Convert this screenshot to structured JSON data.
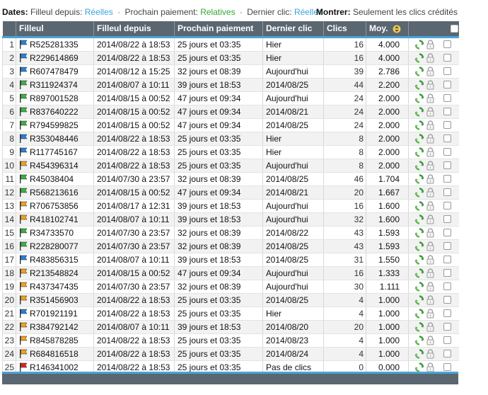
{
  "topbar": {
    "dates_label": "Dates:",
    "filleul_label": "Filleul depuis:",
    "filleul_value": "Réelles",
    "prochain_label": "Prochain paiement:",
    "prochain_value": "Relatives",
    "dernier_label": "Dernier clic:",
    "dernier_value": "Réelles",
    "separator": "·",
    "montrer_label": "Montrer:",
    "montrer_value": "Seulement les clics crédités"
  },
  "table": {
    "headers": {
      "filleul": "Filleul",
      "depuis": "Filleul depuis",
      "prochain": "Prochain paiement",
      "dernier": "Dernier clic",
      "clics": "Clics",
      "moy": "Moy."
    },
    "rows": [
      {
        "n": "1",
        "flag": "blue",
        "id": "R525281335",
        "depuis": "2014/08/22 à 18:53",
        "prochain": "25 jours et 03:35",
        "dernier": "Hier",
        "clics": "16",
        "moy": "4.000"
      },
      {
        "n": "2",
        "flag": "blue",
        "id": "R229614869",
        "depuis": "2014/08/22 à 18:53",
        "prochain": "25 jours et 03:35",
        "dernier": "Hier",
        "clics": "16",
        "moy": "4.000"
      },
      {
        "n": "3",
        "flag": "blue",
        "id": "R607478479",
        "depuis": "2014/08/12 à 15:25",
        "prochain": "32 jours et 08:39",
        "dernier": "Aujourd'hui",
        "clics": "39",
        "moy": "2.786"
      },
      {
        "n": "4",
        "flag": "green",
        "id": "R311924374",
        "depuis": "2014/08/07 à 10:11",
        "prochain": "39 jours et 18:53",
        "dernier": "2014/08/25",
        "clics": "44",
        "moy": "2.200"
      },
      {
        "n": "5",
        "flag": "green",
        "id": "R897001528",
        "depuis": "2014/08/15 à 00:52",
        "prochain": "47 jours et 09:34",
        "dernier": "Aujourd'hui",
        "clics": "24",
        "moy": "2.000"
      },
      {
        "n": "6",
        "flag": "green",
        "id": "R837640222",
        "depuis": "2014/08/15 à 00:52",
        "prochain": "47 jours et 09:34",
        "dernier": "2014/08/21",
        "clics": "24",
        "moy": "2.000"
      },
      {
        "n": "7",
        "flag": "green",
        "id": "R794599825",
        "depuis": "2014/08/15 à 00:52",
        "prochain": "47 jours et 09:34",
        "dernier": "2014/08/25",
        "clics": "24",
        "moy": "2.000"
      },
      {
        "n": "8",
        "flag": "blue",
        "id": "R353048446",
        "depuis": "2014/08/22 à 18:53",
        "prochain": "25 jours et 03:35",
        "dernier": "Hier",
        "clics": "8",
        "moy": "2.000"
      },
      {
        "n": "9",
        "flag": "blue",
        "id": "R117745167",
        "depuis": "2014/08/22 à 18:53",
        "prochain": "25 jours et 03:35",
        "dernier": "Hier",
        "clics": "8",
        "moy": "2.000"
      },
      {
        "n": "10",
        "flag": "orange",
        "id": "R454396314",
        "depuis": "2014/08/22 à 18:53",
        "prochain": "25 jours et 03:35",
        "dernier": "Aujourd'hui",
        "clics": "8",
        "moy": "2.000"
      },
      {
        "n": "11",
        "flag": "green",
        "id": "R45038404",
        "depuis": "2014/07/30 à 23:57",
        "prochain": "32 jours et 08:39",
        "dernier": "2014/08/25",
        "clics": "46",
        "moy": "1.704"
      },
      {
        "n": "12",
        "flag": "green",
        "id": "R568213616",
        "depuis": "2014/08/15 à 00:52",
        "prochain": "47 jours et 09:34",
        "dernier": "2014/08/21",
        "clics": "20",
        "moy": "1.667"
      },
      {
        "n": "13",
        "flag": "orange",
        "id": "R706753856",
        "depuis": "2014/08/17 à 12:31",
        "prochain": "39 jours et 18:53",
        "dernier": "Aujourd'hui",
        "clics": "16",
        "moy": "1.600"
      },
      {
        "n": "14",
        "flag": "orange",
        "id": "R418102741",
        "depuis": "2014/08/07 à 10:11",
        "prochain": "39 jours et 18:53",
        "dernier": "Aujourd'hui",
        "clics": "32",
        "moy": "1.600"
      },
      {
        "n": "15",
        "flag": "green",
        "id": "R34733570",
        "depuis": "2014/07/30 à 23:57",
        "prochain": "32 jours et 08:39",
        "dernier": "2014/08/22",
        "clics": "43",
        "moy": "1.593"
      },
      {
        "n": "16",
        "flag": "green",
        "id": "R228280077",
        "depuis": "2014/07/30 à 23:57",
        "prochain": "32 jours et 08:39",
        "dernier": "2014/08/25",
        "clics": "43",
        "moy": "1.593"
      },
      {
        "n": "17",
        "flag": "blue",
        "id": "R483856315",
        "depuis": "2014/08/07 à 10:11",
        "prochain": "39 jours et 18:53",
        "dernier": "2014/08/25",
        "clics": "31",
        "moy": "1.550"
      },
      {
        "n": "18",
        "flag": "orange",
        "id": "R213548824",
        "depuis": "2014/08/15 à 00:52",
        "prochain": "47 jours et 09:34",
        "dernier": "Aujourd'hui",
        "clics": "16",
        "moy": "1.333"
      },
      {
        "n": "19",
        "flag": "orange",
        "id": "R437347435",
        "depuis": "2014/07/30 à 23:57",
        "prochain": "32 jours et 08:39",
        "dernier": "Aujourd'hui",
        "clics": "30",
        "moy": "1.111"
      },
      {
        "n": "20",
        "flag": "orange",
        "id": "R351456903",
        "depuis": "2014/08/22 à 18:53",
        "prochain": "25 jours et 03:35",
        "dernier": "2014/08/25",
        "clics": "4",
        "moy": "1.000"
      },
      {
        "n": "21",
        "flag": "blue",
        "id": "R701921191",
        "depuis": "2014/08/22 à 18:53",
        "prochain": "25 jours et 03:35",
        "dernier": "Hier",
        "clics": "4",
        "moy": "1.000"
      },
      {
        "n": "22",
        "flag": "orange",
        "id": "R384792142",
        "depuis": "2014/08/07 à 10:11",
        "prochain": "39 jours et 18:53",
        "dernier": "2014/08/20",
        "clics": "20",
        "moy": "1.000"
      },
      {
        "n": "23",
        "flag": "orange",
        "id": "R845878285",
        "depuis": "2014/08/22 à 18:53",
        "prochain": "25 jours et 03:35",
        "dernier": "2014/08/23",
        "clics": "4",
        "moy": "1.000"
      },
      {
        "n": "24",
        "flag": "orange",
        "id": "R684816518",
        "depuis": "2014/08/22 à 18:53",
        "prochain": "25 jours et 03:35",
        "dernier": "2014/08/24",
        "clics": "4",
        "moy": "1.000"
      },
      {
        "n": "25",
        "flag": "red",
        "id": "R146341002",
        "depuis": "2014/08/22 à 18:53",
        "prochain": "25 jours et 03:35",
        "dernier": "Pas de clics",
        "clics": "0",
        "moy": "0.000"
      }
    ]
  },
  "colors": {
    "header_bg": "#5a6670",
    "accent_blue": "#4aa3d6",
    "link_blue": "#3ba3d8",
    "link_green": "#33a533",
    "flag_blue": "#2a7fd4",
    "flag_green": "#3cb043",
    "flag_orange": "#f0a020",
    "flag_red": "#e02020"
  },
  "icons": {
    "flag": "flag-icon",
    "recycle": "recycle-icon",
    "lock": "lock-icon",
    "sort": "sort-arrows-icon"
  }
}
